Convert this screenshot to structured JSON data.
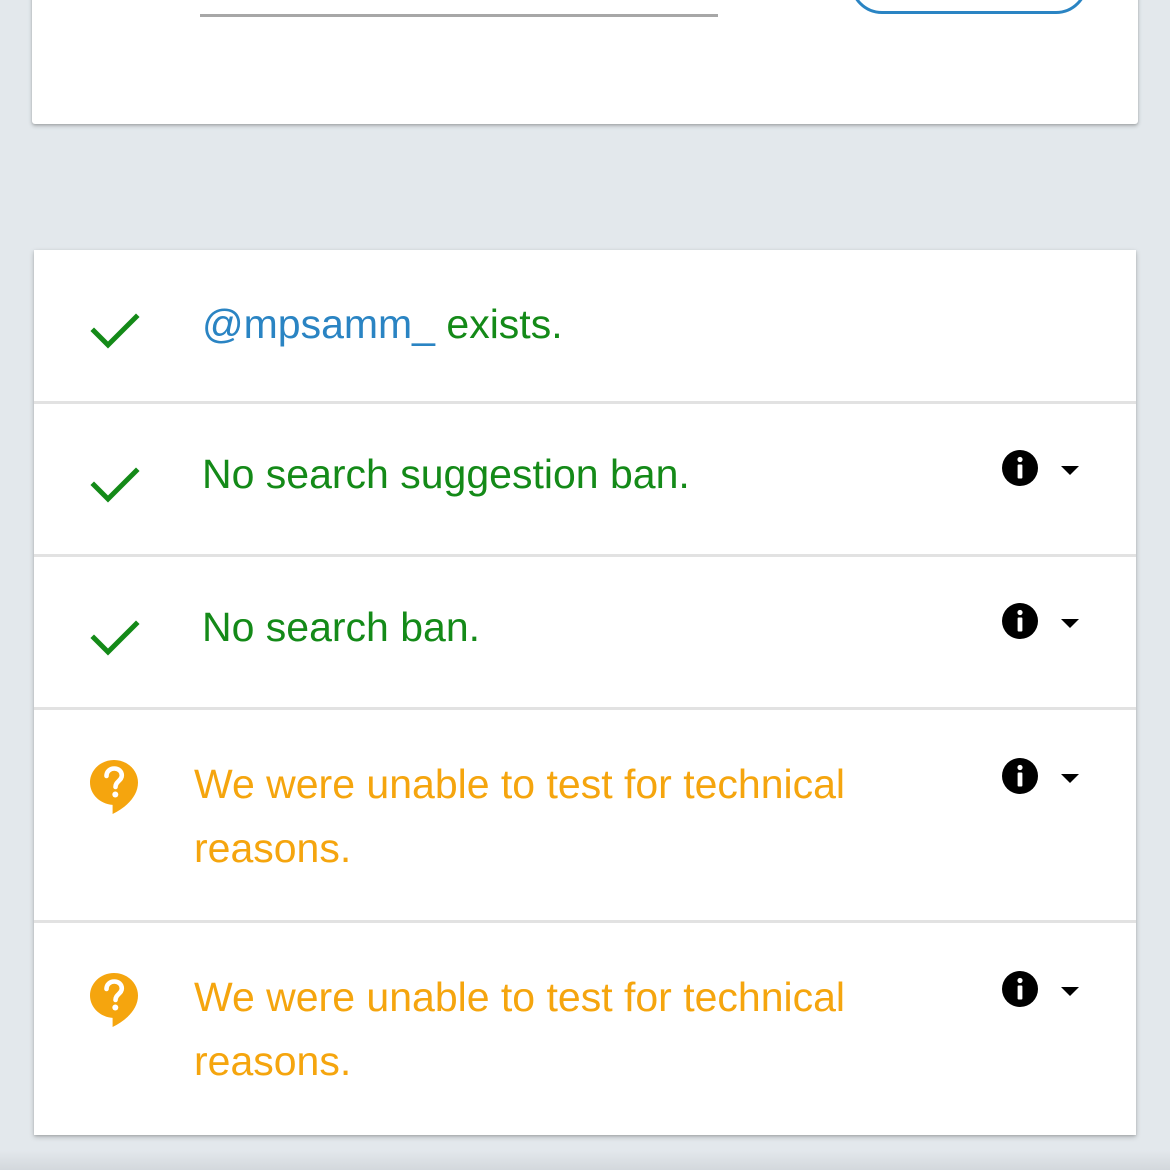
{
  "search": {
    "username_value": "",
    "button_label": ""
  },
  "results": [
    {
      "status": "ok",
      "icon": "check-icon",
      "username": "@mpsamm_",
      "text": " exists.",
      "has_details": false
    },
    {
      "status": "ok",
      "icon": "check-icon",
      "text": "No search suggestion ban.",
      "has_details": true
    },
    {
      "status": "ok",
      "icon": "check-icon",
      "text": "No search ban.",
      "has_details": true
    },
    {
      "status": "unknown",
      "icon": "question-bubble-icon",
      "text": "We were unable to test for technical reasons.",
      "has_details": true
    },
    {
      "status": "unknown",
      "icon": "question-bubble-icon",
      "text": "We were unable to test for technical reasons.",
      "has_details": true
    }
  ],
  "colors": {
    "ok": "#148a18",
    "warning": "#f5a50e",
    "link": "#2a84c3",
    "background": "#e3e8ec"
  }
}
